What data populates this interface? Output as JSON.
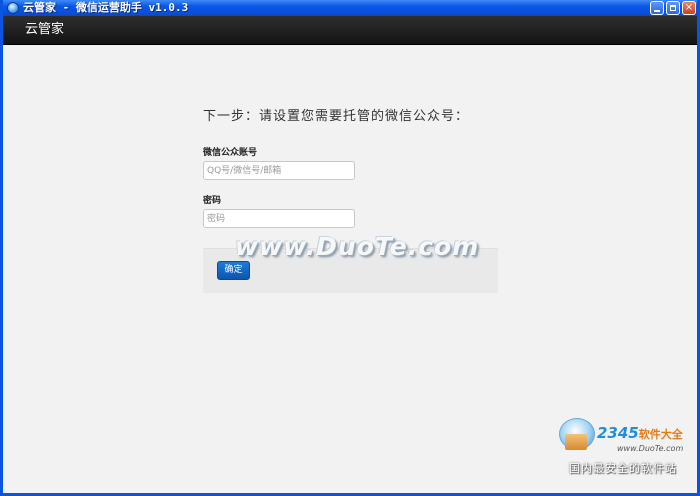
{
  "window": {
    "title": "云管家 - 微信运营助手 v1.0.3",
    "controls": {
      "minimize": "minimize-icon",
      "maximize": "maximize-icon",
      "close": "×"
    }
  },
  "header": {
    "brand": "云管家"
  },
  "form": {
    "step_title": "下一步：请设置您需要托管的微信公众号：",
    "account_label": "微信公众账号",
    "account_placeholder": "QQ号/微信号/邮箱",
    "account_value": "",
    "password_label": "密码",
    "password_placeholder": "密码",
    "password_value": "",
    "confirm_label": "确定"
  },
  "watermark": {
    "text": "www.DuoTe.com"
  },
  "corner_logo": {
    "brand": "2345",
    "brand_suffix": "软件大全",
    "url": "www.DuoTe.com",
    "slogan": "国内最安全的软件站"
  },
  "colors": {
    "titlebar": "#0b55e6",
    "header": "#1e1e1e",
    "button": "#0a55b3"
  }
}
